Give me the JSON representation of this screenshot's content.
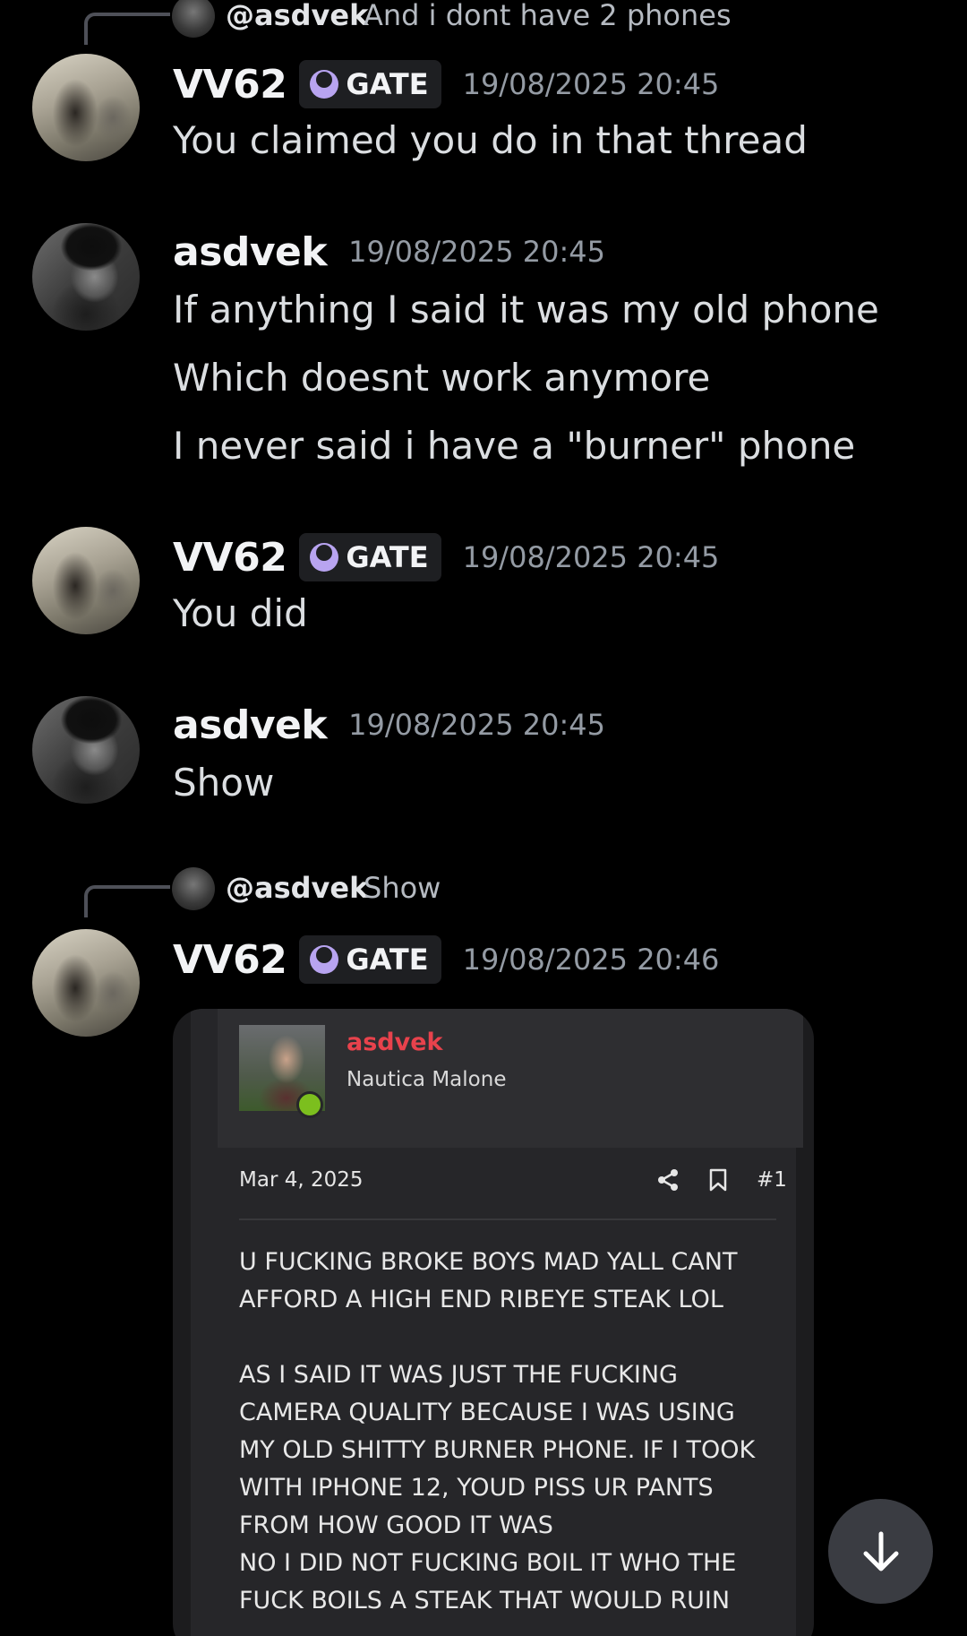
{
  "replies": [
    {
      "user": "@asdvek",
      "text": "And i dont have 2 phones"
    },
    {
      "user": "@asdvek",
      "text": "Show"
    }
  ],
  "tag_label": "GATE",
  "messages": [
    {
      "user": "VV62",
      "time": "19/08/2025 20:45",
      "lines": [
        "You claimed you do in that thread"
      ]
    },
    {
      "user": "asdvek",
      "time": "19/08/2025 20:45",
      "lines": [
        "If anything I said it was my old phone",
        "Which doesnt work anymore",
        "I never said i have a \"burner\" phone"
      ]
    },
    {
      "user": "VV62",
      "time": "19/08/2025 20:45",
      "lines": [
        "You did"
      ]
    },
    {
      "user": "asdvek",
      "time": "19/08/2025 20:45",
      "lines": [
        "Show"
      ]
    },
    {
      "user": "VV62",
      "time": "19/08/2025 20:46",
      "lines": []
    }
  ],
  "embed": {
    "username": "asdvek",
    "user_title": "Nautica Malone",
    "date": "Mar 4, 2025",
    "post_number": "#1",
    "paragraphs": [
      [
        "U FUCKING BROKE BOYS MAD YALL CANT",
        "AFFORD A HIGH END RIBEYE STEAK LOL"
      ],
      [
        "AS I SAID IT WAS JUST THE FUCKING",
        "CAMERA QUALITY BECAUSE I WAS USING",
        "MY OLD SHITTY BURNER PHONE. IF I TOOK",
        "WITH IPHONE 12, YOUD PISS UR PANTS",
        "FROM HOW GOOD IT WAS"
      ],
      [
        "NO I DID NOT FUCKING BOIL IT WHO THE",
        "FUCK BOILS A STEAK THAT WOULD RUIN"
      ]
    ]
  },
  "colors": {
    "background": "#000000",
    "timestamp": "#949ba4",
    "embed_username": "#e8424c",
    "online_dot": "#7cbf1e",
    "gate_icon": "#b8a4f0"
  }
}
